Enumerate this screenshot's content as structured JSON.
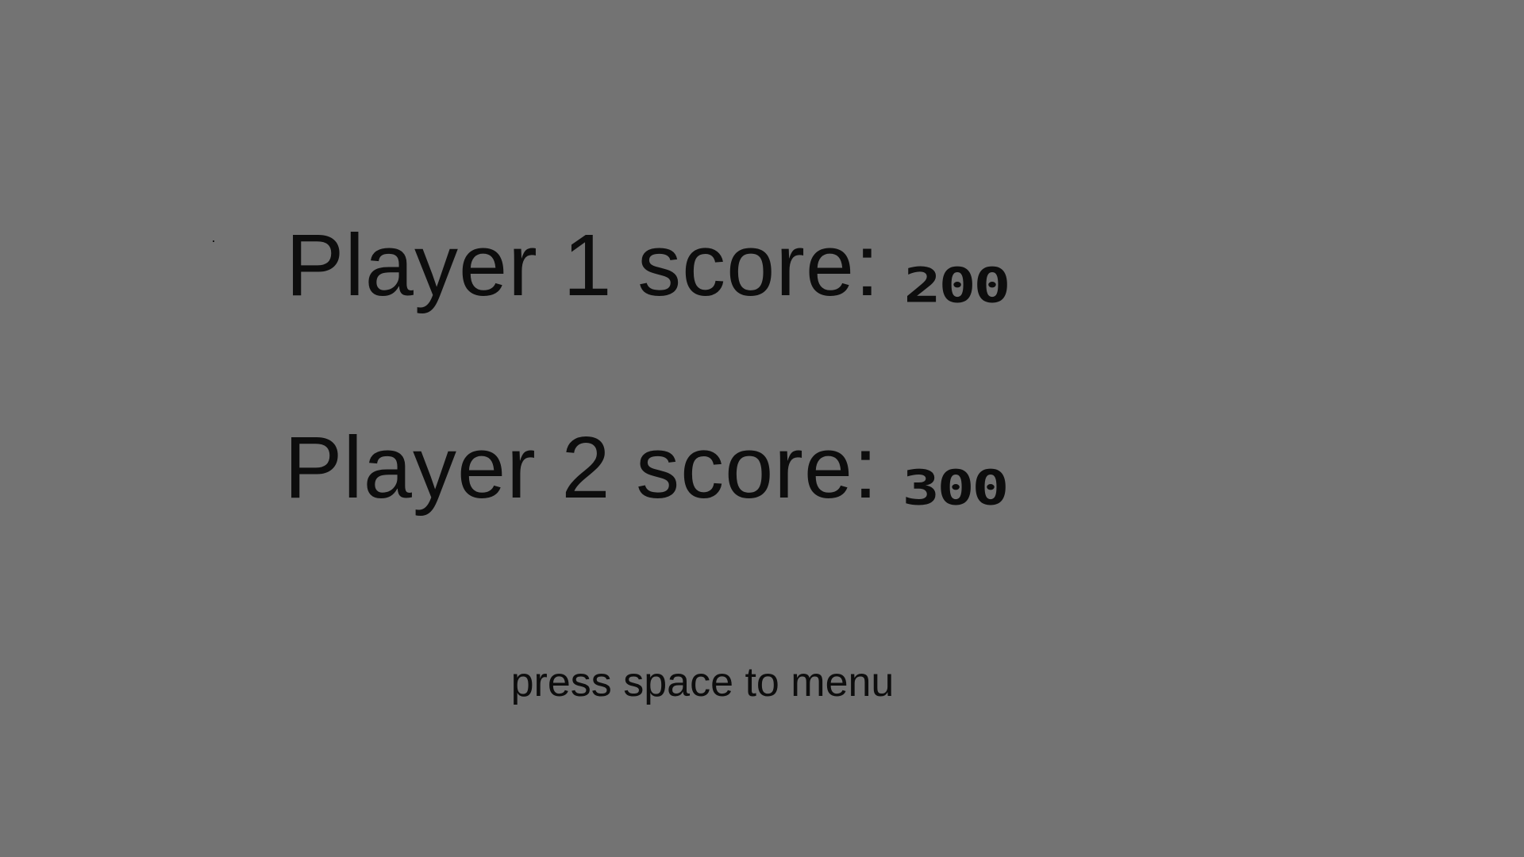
{
  "scores": [
    {
      "label": "Player 1 score:",
      "value": "200"
    },
    {
      "label": "Player 2 score:",
      "value": "300"
    }
  ],
  "hint": "press space to menu",
  "colors": {
    "background": "#737373",
    "text": "#0d0d0d"
  }
}
